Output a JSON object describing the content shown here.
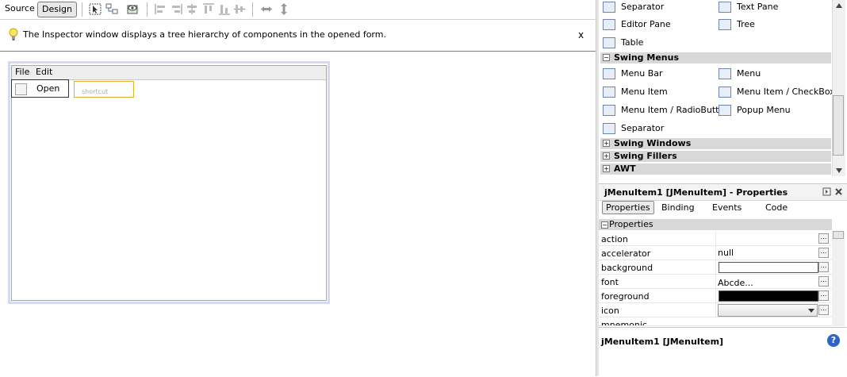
{
  "toolbar": {
    "source_label": "Source",
    "design_label": "Design"
  },
  "infobar": {
    "text": "The Inspector window displays a tree hierarchy of components in the opened form.",
    "close": "x"
  },
  "form": {
    "menu_file": "File",
    "menu_edit": "Edit",
    "menu_item_label": "Open",
    "shortcut_placeholder": "shortcut"
  },
  "palette": {
    "items_top": [
      {
        "label": "Separator"
      },
      {
        "label": "Text Pane"
      },
      {
        "label": "Editor Pane"
      },
      {
        "label": "Tree"
      },
      {
        "label": "Table"
      }
    ],
    "swing_menus": {
      "title": "Swing Menus",
      "items": [
        {
          "label": "Menu Bar"
        },
        {
          "label": "Menu"
        },
        {
          "label": "Menu Item"
        },
        {
          "label": "Menu Item / CheckBox"
        },
        {
          "label": "Menu Item / RadioButton"
        },
        {
          "label": "Popup Menu"
        },
        {
          "label": "Separator"
        }
      ]
    },
    "categories": [
      {
        "title": "Swing Windows"
      },
      {
        "title": "Swing Fillers"
      },
      {
        "title": "AWT"
      }
    ]
  },
  "properties": {
    "header_title": "jMenuItem1 [JMenuItem] - Properties",
    "tabs": [
      "Properties",
      "Binding",
      "Events",
      "Code"
    ],
    "section": "Properties",
    "rows": [
      {
        "name": "action",
        "value": ""
      },
      {
        "name": "accelerator",
        "value": "null"
      },
      {
        "name": "background",
        "value": ""
      },
      {
        "name": "font",
        "value": "Abcde..."
      },
      {
        "name": "foreground",
        "value": ""
      },
      {
        "name": "icon",
        "value": ""
      },
      {
        "name": "mnemonic",
        "value": ""
      }
    ],
    "ellipsis": "..."
  },
  "description": {
    "title": "jMenuItem1 [JMenuItem]",
    "help": "?"
  },
  "colors": {
    "foreground_swatch": "#000000",
    "background_swatch": "#ffffff",
    "help_icon": "#2e63c7"
  }
}
